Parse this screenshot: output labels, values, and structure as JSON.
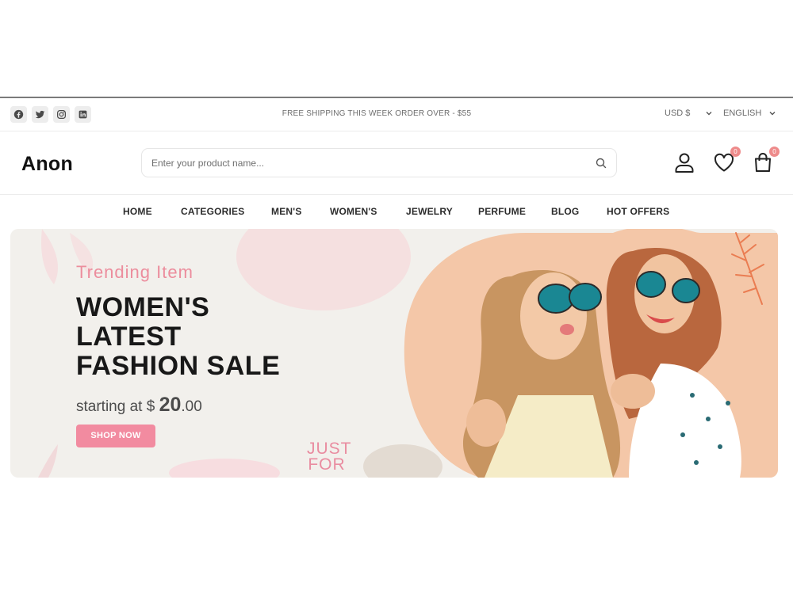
{
  "topbar": {
    "social_icons": [
      "facebook-icon",
      "twitter-icon",
      "instagram-icon",
      "linkedin-icon"
    ],
    "shipping_text": "FREE SHIPPING THIS WEEK ORDER OVER - $55",
    "currency": "USD $",
    "language": "ENGLISH"
  },
  "header": {
    "logo": "Anon",
    "search_placeholder": "Enter your product name...",
    "wishlist_count": "0",
    "cart_count": "0"
  },
  "nav": {
    "items": [
      "HOME",
      "CATEGORIES",
      "MEN'S",
      "WOMEN'S",
      "JEWELRY",
      "PERFUME",
      "BLOG",
      "HOT OFFERS"
    ]
  },
  "banner": {
    "subtitle": "Trending Item",
    "title_lines": [
      "WOMEN'S",
      "LATEST",
      "FASHION SALE"
    ],
    "price_prefix": "starting at $ ",
    "price_main": "20",
    "price_cents": ".00",
    "button": "SHOP NOW",
    "decor_text": "JUST FOR"
  },
  "colors": {
    "accent_pink": "#f28ba0",
    "subtitle_pink": "#ec8d9d",
    "badge": "#ee8b8b",
    "banner_bg": "#f2f0ec"
  }
}
